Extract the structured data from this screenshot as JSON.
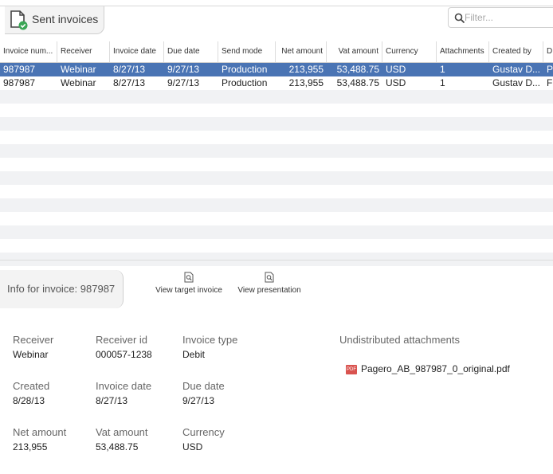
{
  "header": {
    "tab_title": "Sent invoices",
    "filter_placeholder": "Filter..."
  },
  "table": {
    "columns": [
      "Invoice num...",
      "Receiver",
      "Invoice date",
      "Due date",
      "Send mode",
      "Net amount",
      "Vat amount",
      "Currency",
      "Attachments",
      "Created by",
      "D"
    ],
    "rows": [
      {
        "invoice": "987987",
        "receiver": "Webinar",
        "invoice_date": "8/27/13",
        "due_date": "9/27/13",
        "send_mode": "Production",
        "net": "213,955",
        "vat": "53,488.75",
        "currency": "USD",
        "attachments": "1",
        "created_by": "Gustav D...",
        "d": "P"
      },
      {
        "invoice": "987987",
        "receiver": "Webinar",
        "invoice_date": "8/27/13",
        "due_date": "9/27/13",
        "send_mode": "Production",
        "net": "213,955",
        "vat": "53,488.75",
        "currency": "USD",
        "attachments": "1",
        "created_by": "Gustav D...",
        "d": "F"
      }
    ]
  },
  "info": {
    "tab_label": "Info for invoice: 987987",
    "view_target_label": "View target invoice",
    "view_presentation_label": "View presentation"
  },
  "details": {
    "receiver_label": "Receiver",
    "receiver_value": "Webinar",
    "receiver_id_label": "Receiver id",
    "receiver_id_value": "000057-1238",
    "invoice_type_label": "Invoice type",
    "invoice_type_value": "Debit",
    "created_label": "Created",
    "created_value": "8/28/13",
    "invoice_date_label": "Invoice date",
    "invoice_date_value": "8/27/13",
    "due_date_label": "Due date",
    "due_date_value": "9/27/13",
    "net_label": "Net amount",
    "net_value": "213,955",
    "vat_label": "Vat amount",
    "vat_value": "53,488.75",
    "currency_label": "Currency",
    "currency_value": "USD",
    "attachments_title": "Undistributed attachments",
    "attachment_file": "Pagero_AB_987987_0_original.pdf",
    "pdf_badge": "PDF"
  },
  "colors": {
    "selected_row": "#4a74b4",
    "accent_green": "#3aa655"
  }
}
